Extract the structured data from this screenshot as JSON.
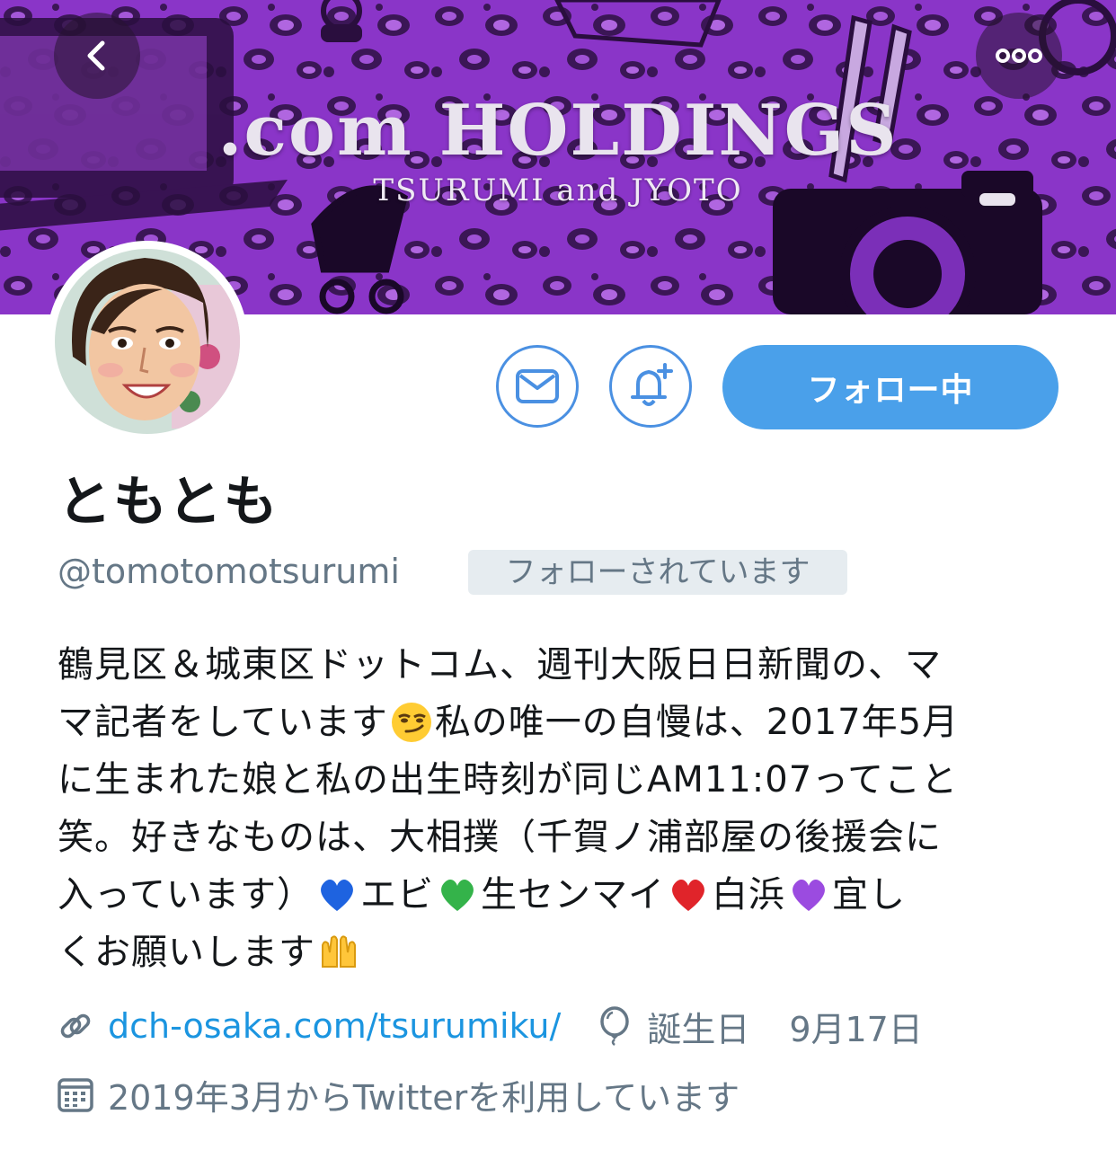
{
  "banner": {
    "title": ".com HOLDINGS",
    "subtitle": "TSURUMI and JYOTO"
  },
  "icons": {
    "back": "chevron-left-icon",
    "more": "more-horizontal-icon",
    "dm": "envelope-icon",
    "notify": "bell-plus-icon",
    "link": "link-icon",
    "birthday": "balloon-icon",
    "joined": "calendar-icon"
  },
  "actions": {
    "follow_label": "フォロー中"
  },
  "profile": {
    "name": "ともとも",
    "handle": "@tomotomotsurumi",
    "follows_you": "フォローされています"
  },
  "bio": {
    "l1": "鶴見区＆城東区ドットコム、週刊大阪日日新聞の、マ",
    "l2a": "マ記者をしています",
    "l2b": "私の唯一の自慢は、2017年5月",
    "l3": "に生まれた娘と私の出生時刻が同じAM11:07ってこと",
    "l4": "笑。好きなものは、大相撲（千賀ノ浦部屋の後援会に",
    "l5a": "入っています）",
    "l5b": "エビ",
    "l5c": "生センマイ",
    "l5d": "白浜",
    "l5e": "宜し",
    "l6a": "くお願いします",
    "emojis": [
      "smirk",
      "blue-heart",
      "green-heart",
      "red-heart",
      "purple-heart",
      "raised-hands"
    ]
  },
  "meta": {
    "url": "dch-osaka.com/tsurumiku/",
    "birthday_label": "誕生日",
    "birthday_value": "9月17日",
    "joined": "2019年3月からTwitterを利用しています"
  },
  "colors": {
    "accent": "#4aa0ea",
    "link": "#1b95e0",
    "muted": "#657786",
    "banner": "#7b2fb8"
  }
}
